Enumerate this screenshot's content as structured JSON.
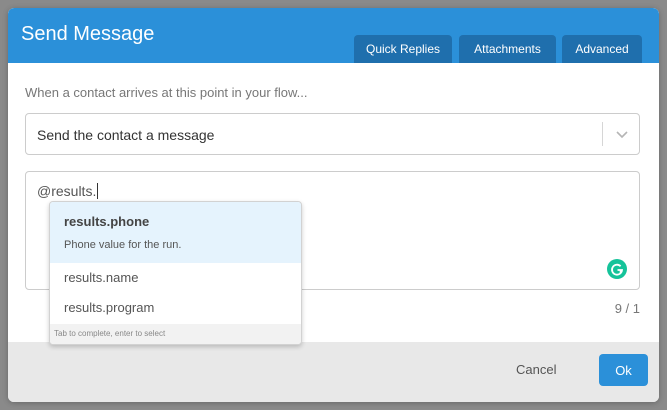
{
  "dialog": {
    "title": "Send Message",
    "tabs": [
      "Quick Replies",
      "Attachments",
      "Advanced"
    ]
  },
  "form": {
    "intro": "When a contact arrives at this point in your flow...",
    "action_select": {
      "selected": "Send the contact a message"
    },
    "message_value": "@results.",
    "counter": "9 / 1"
  },
  "autocomplete": {
    "options": [
      {
        "label": "results.phone",
        "description": "Phone value for the run."
      },
      {
        "label": "results.name"
      },
      {
        "label": "results.program"
      }
    ],
    "hint": "Tab to complete, enter to select"
  },
  "footer": {
    "cancel_label": "Cancel",
    "ok_label": "Ok"
  },
  "colors": {
    "primary": "#2b90d9",
    "tab": "#1f6fad",
    "highlight": "#e5f3fd",
    "grammarly": "#15c39a"
  },
  "icons": {
    "dropdown": "chevron-down-icon",
    "grammarly": "grammarly-icon"
  }
}
